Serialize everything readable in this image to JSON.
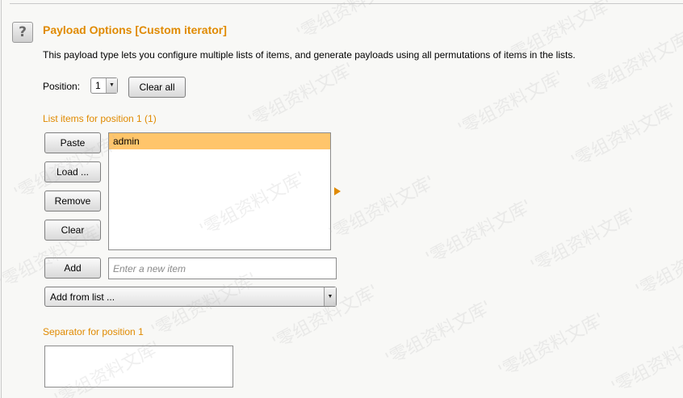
{
  "header": {
    "help_icon": "question-mark-icon",
    "help_glyph": "?",
    "title": "Payload Options [Custom iterator]",
    "description": "This payload type lets you configure multiple lists of items, and generate payloads using all permutations of items in the lists."
  },
  "position": {
    "label": "Position:",
    "selected": "1",
    "clear_all_label": "Clear all"
  },
  "list": {
    "heading": "List items for position 1 (1)",
    "buttons": {
      "paste": "Paste",
      "load": "Load ...",
      "remove": "Remove",
      "clear": "Clear",
      "add": "Add"
    },
    "items": [
      "admin"
    ],
    "selected_index": 0,
    "new_item_placeholder": "Enter a new item",
    "add_from_list_label": "Add from list ..."
  },
  "separator": {
    "heading": "Separator for position 1",
    "value": ""
  },
  "watermark": "'零组资料文库'",
  "colors": {
    "accent": "#e08a00",
    "selection": "#ffc56b",
    "background": "#f8f8f6"
  }
}
